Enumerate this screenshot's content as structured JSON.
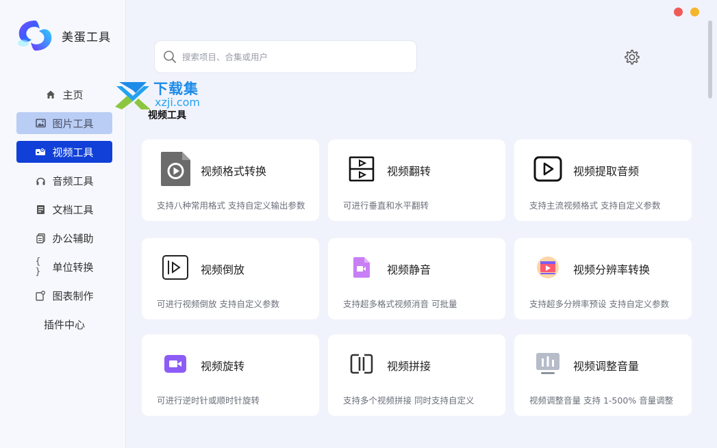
{
  "app": {
    "name": "美蛋工具"
  },
  "sidebar": {
    "items": [
      {
        "label": "主页",
        "icon": "home-icon",
        "state": "normal"
      },
      {
        "label": "图片工具",
        "icon": "image-icon",
        "state": "hover"
      },
      {
        "label": "视频工具",
        "icon": "video-icon",
        "state": "active"
      },
      {
        "label": "音频工具",
        "icon": "headphone-icon",
        "state": "normal"
      },
      {
        "label": "文档工具",
        "icon": "document-icon",
        "state": "normal"
      },
      {
        "label": "办公辅助",
        "icon": "clipboard-icon",
        "state": "normal"
      },
      {
        "label": "单位转换",
        "icon": "braces-icon",
        "state": "normal"
      },
      {
        "label": "图表制作",
        "icon": "chart-icon",
        "state": "normal"
      },
      {
        "label": "插件中心",
        "icon": "",
        "state": "normal"
      }
    ]
  },
  "search": {
    "placeholder": "搜索项目、合集或用户",
    "value": ""
  },
  "watermark": {
    "title": "下载集",
    "sub": "xzji.com"
  },
  "section": {
    "title": "视频工具"
  },
  "cards": [
    {
      "title": "视频格式转换",
      "desc": "支持八种常用格式 支持自定义输出参数",
      "icon": "video-file-icon"
    },
    {
      "title": "视频翻转",
      "desc": "可进行垂直和水平翻转",
      "icon": "video-flip-icon"
    },
    {
      "title": "视频提取音频",
      "desc": "支持主流视频格式 支持自定义参数",
      "icon": "video-play-box-icon"
    },
    {
      "title": "视频倒放",
      "desc": "可进行视频倒放 支持自定义参数",
      "icon": "video-reverse-icon"
    },
    {
      "title": "视频静音",
      "desc": "支持超多格式视频消音 可批量",
      "icon": "video-mute-icon"
    },
    {
      "title": "视频分辨率转换",
      "desc": "支持超多分辨率预设 支持自定义参数",
      "icon": "resolution-icon"
    },
    {
      "title": "视频旋转",
      "desc": "可进行逆时针或顺时针旋转",
      "icon": "video-camera-icon"
    },
    {
      "title": "视频拼接",
      "desc": "支持多个视频拼接 同时支持自定义",
      "icon": "video-join-icon"
    },
    {
      "title": "视频调整音量",
      "desc": "视频调整音量 支持 1-500% 音量调整",
      "icon": "volume-bars-icon"
    }
  ],
  "colors": {
    "accent": "#1040d8",
    "hover": "#b9cdf5",
    "close": "#f05a57",
    "minimize": "#f5b62b"
  }
}
